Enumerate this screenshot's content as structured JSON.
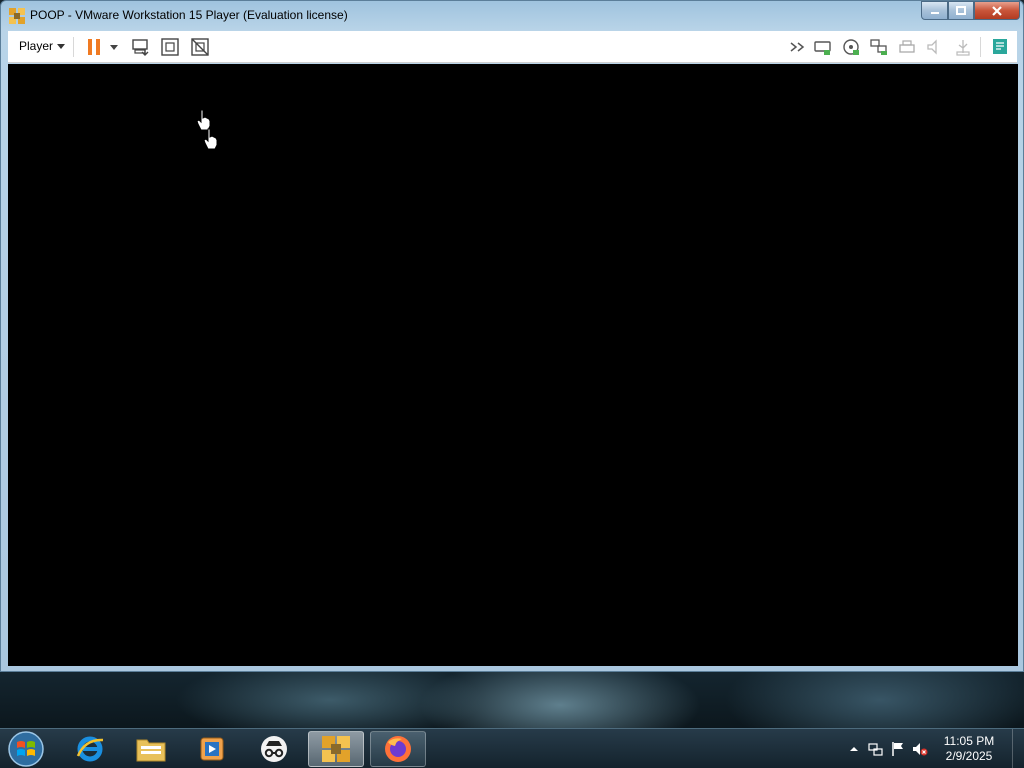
{
  "window": {
    "title": "POOP - VMware Workstation 15 Player (Evaluation license)",
    "controls": {
      "minimize": "—",
      "maximize": "□",
      "close": "✕"
    }
  },
  "toolbar": {
    "player_label": "Player",
    "left_icons": [
      "pause-icon",
      "dropdown-caret-icon",
      "send-ctrl-alt-del-icon",
      "fit-guest-icon",
      "unity-icon"
    ],
    "right_icons": [
      "more-devices-icon",
      "hard-disk-icon",
      "cd-dvd-icon",
      "network-adapter-icon",
      "printer-icon",
      "sound-icon",
      "usb-icon",
      "message-log-icon"
    ],
    "accent": "#f07a22"
  },
  "vm_screen": {
    "background": "#000000"
  },
  "taskbar": {
    "apps": [
      "start-orb-icon",
      "internet-explorer-icon",
      "file-explorer-icon",
      "media-player-icon",
      "incognito-icon",
      "vmware-icon",
      "firefox-icon"
    ],
    "tray_icons": [
      "show-hidden-icons-icon",
      "network-icon",
      "action-center-flag-icon",
      "volume-muted-icon"
    ],
    "clock": {
      "time": "11:05 PM",
      "date": "2/9/2025"
    }
  }
}
